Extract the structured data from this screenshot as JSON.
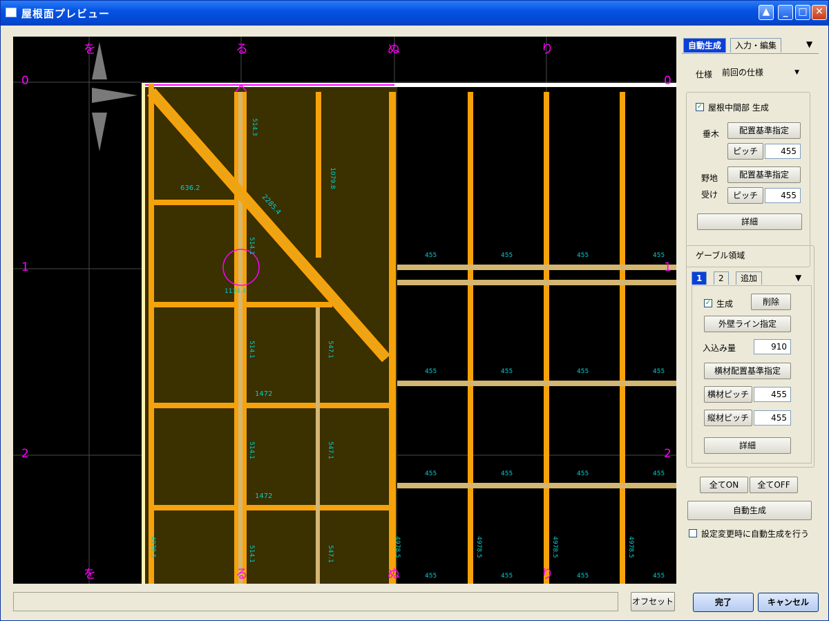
{
  "window": {
    "title": "屋根面プレビュー",
    "controls": {
      "help": "▲",
      "minimize": "_",
      "maximize": "□",
      "close": "✕"
    }
  },
  "canvas": {
    "col_labels_top": [
      "を",
      "る",
      "ぬ",
      "り"
    ],
    "col_labels_bottom": [
      "を",
      "る",
      "ぬ",
      "り"
    ],
    "row_labels_left": [
      "0",
      "1",
      "2"
    ],
    "row_labels_right": [
      "0",
      "1",
      "2"
    ],
    "dims": {
      "d1": "514.3",
      "d2": "1079.8",
      "d3": "636.2",
      "d4": "2285.4",
      "d5": "514.1",
      "d6": "1134.4",
      "d7": "514.1",
      "d8": "547.1",
      "d9": "1472",
      "d10": "514.1",
      "d11": "547.1",
      "d12": "1472",
      "d13": "4978.5",
      "d14": "514.1",
      "d15": "547.1",
      "d16": "4978.5",
      "d17": "4978.5",
      "d18": "4978.5",
      "d19": "4978.5"
    },
    "pitch_label": "455",
    "colors": {
      "grid": "#4a4a4a",
      "magenta": "#ff00ff",
      "orange": "#f5a20b",
      "tan": "#d4b673",
      "roof_fill": "#3a3000",
      "dim_text": "#00d0d0"
    }
  },
  "status_bar": {
    "text": ""
  },
  "offset_button": "オフセット",
  "done_button": "完了",
  "cancel_button": "キャンセル",
  "panel": {
    "tabs": [
      "自動生成",
      "入力・編集"
    ],
    "spec_label": "仕様",
    "spec_value": "前回の仕様",
    "roof_mid_label": "屋根中間部 生成",
    "taruki_label": "垂木",
    "placement_ref_btn": "配置基準指定",
    "pitch_btn": "ピッチ",
    "taruki_pitch": "455",
    "noji_label1": "野地",
    "noji_label2": "受け",
    "placement_ref_btn2": "配置基準指定",
    "pitch_btn2": "ピッチ",
    "noji_pitch": "455",
    "detail_btn": "詳細",
    "gable_group": "ゲーブル領域",
    "gable_tabs": [
      "1",
      "2",
      "追加"
    ],
    "gable_generate": "生成",
    "delete_btn": "削除",
    "outer_wall_btn": "外壁ライン指定",
    "inset_label": "入込み量",
    "inset_value": "910",
    "horiz_ref_btn": "横材配置基準指定",
    "horiz_pitch_btn": "横材ピッチ",
    "horiz_pitch": "455",
    "vert_pitch_btn": "縦材ピッチ",
    "vert_pitch": "455",
    "detail_btn2": "詳細",
    "all_on": "全てON",
    "all_off": "全てOFF",
    "auto_gen": "自動生成",
    "auto_on_change": "設定変更時に自動生成を行う"
  }
}
